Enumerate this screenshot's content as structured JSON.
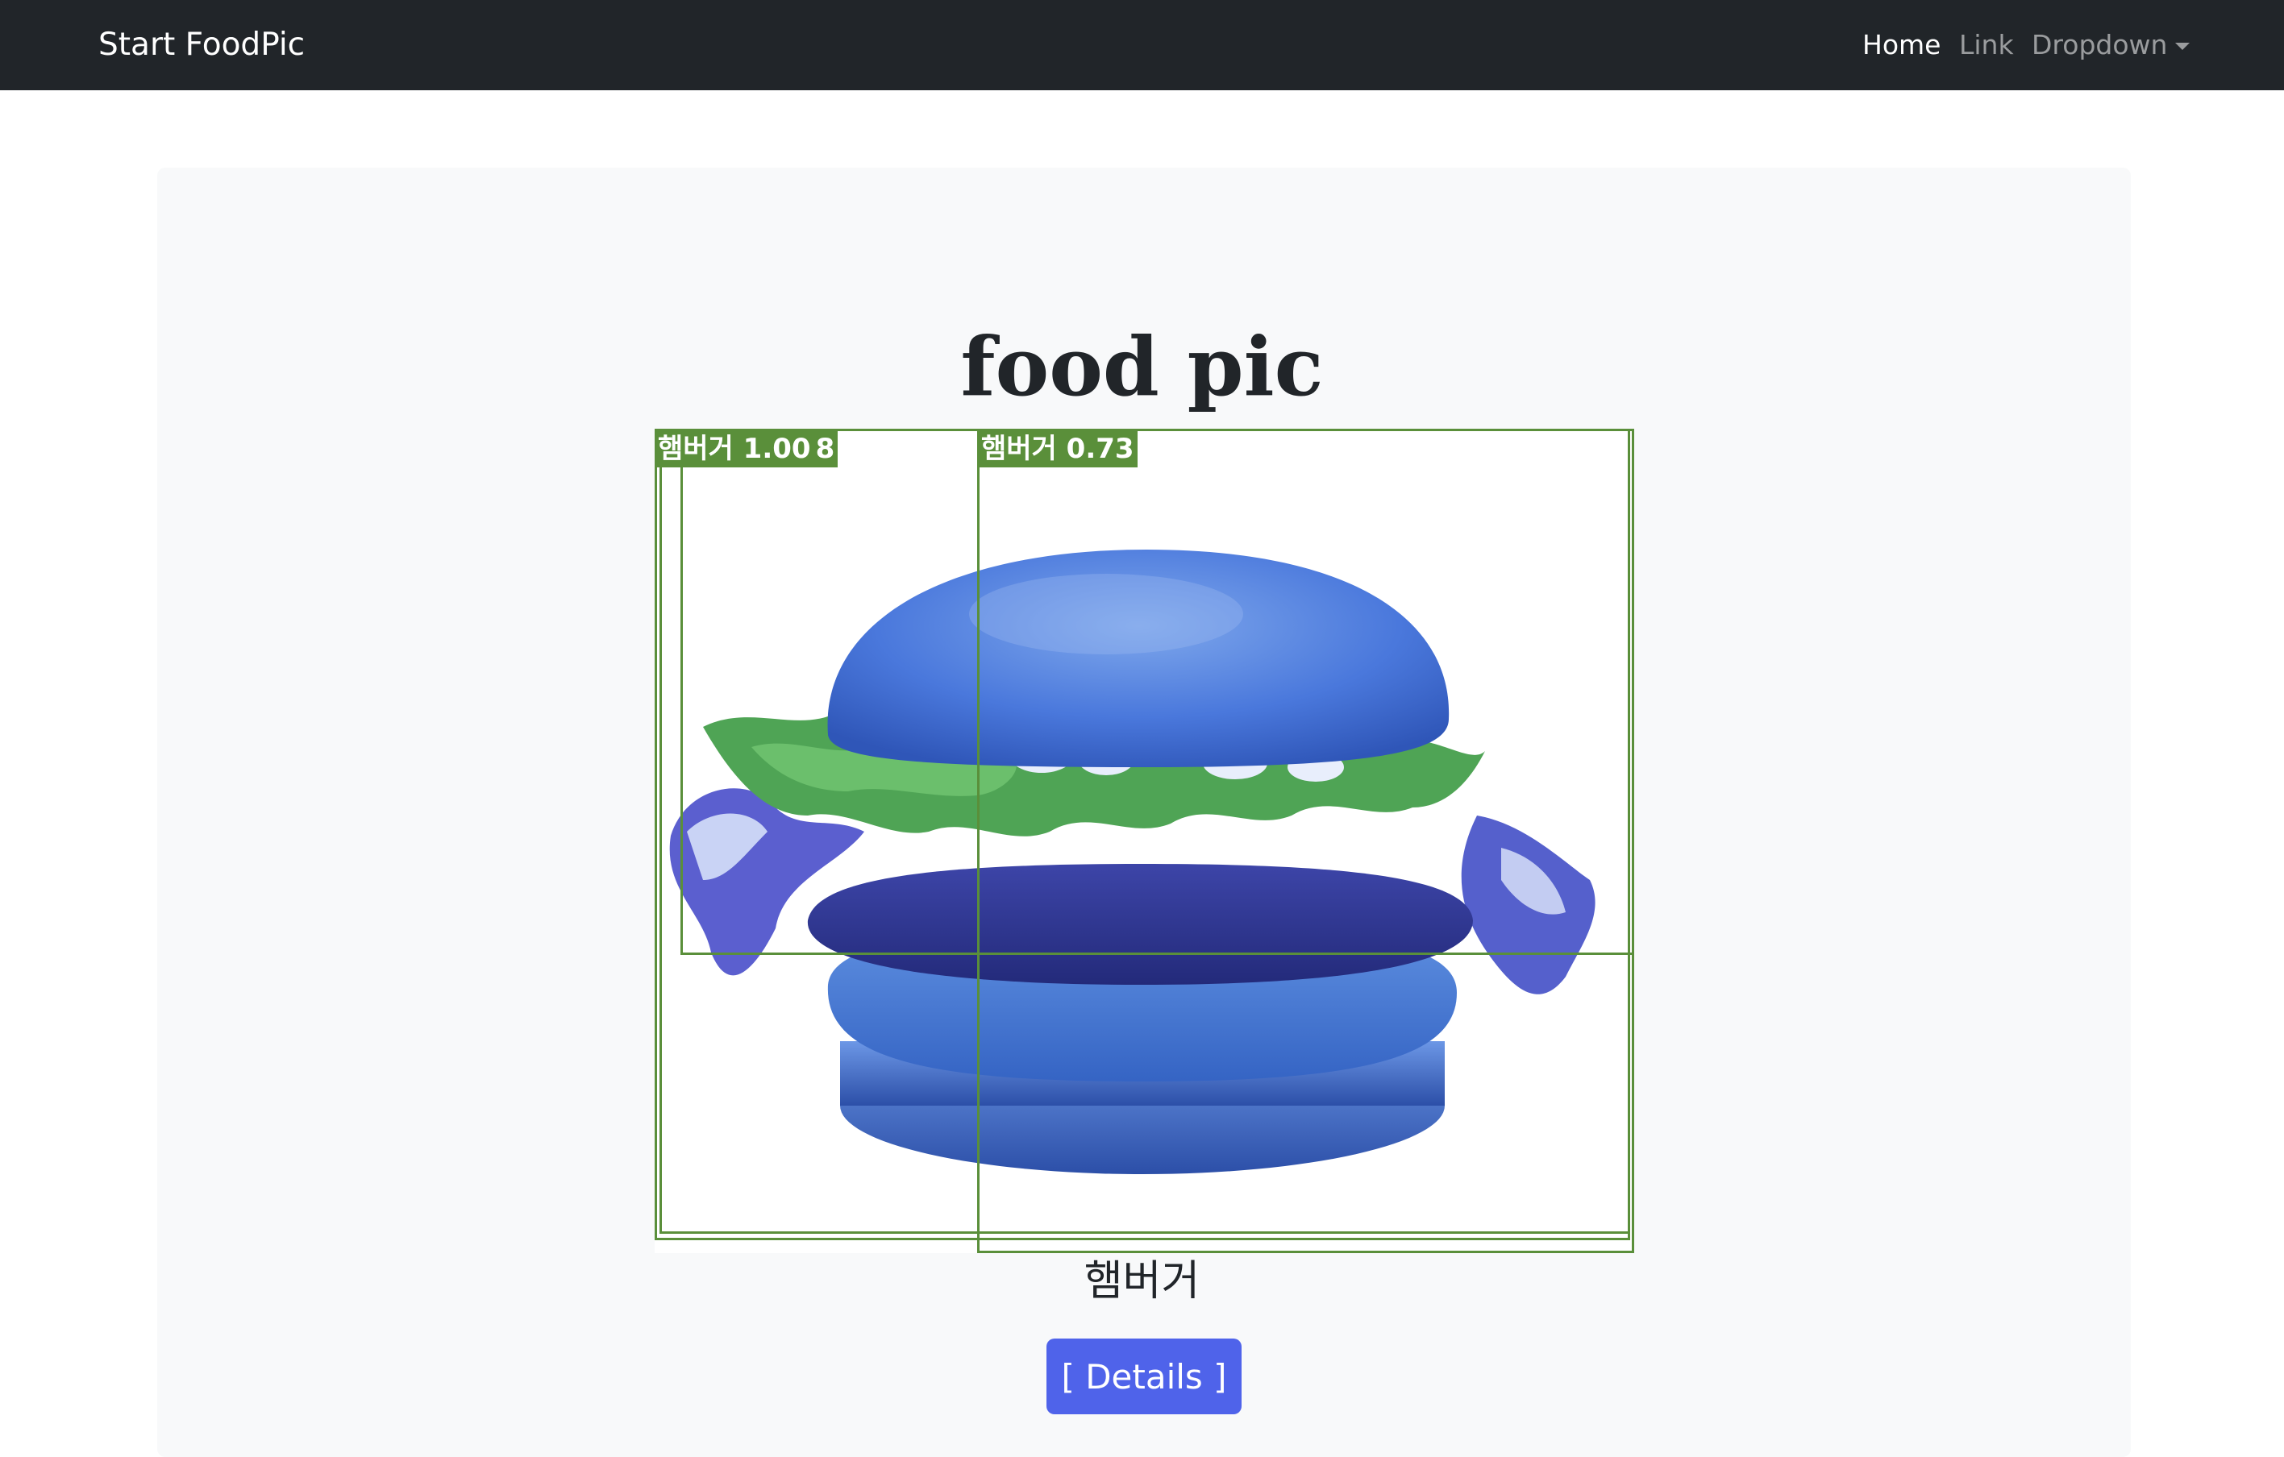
{
  "navbar": {
    "brand": "Start FoodPic",
    "items": [
      {
        "label": "Home",
        "active": true
      },
      {
        "label": "Link",
        "active": false
      },
      {
        "label": "Dropdown",
        "active": false
      }
    ]
  },
  "main": {
    "title": "food pic",
    "detections": [
      {
        "label": "햄버거 1.00",
        "overlap_text": "8"
      },
      {
        "label": "햄버거 0.73"
      }
    ],
    "image_subject": "blue hamburger photo",
    "caption": "햄버거",
    "details_button": "[ Details ]"
  },
  "colors": {
    "navbar_bg": "#212529",
    "panel_bg": "#f8f9fa",
    "detection_box": "#5a8f3a",
    "button_bg": "#4f63ea"
  }
}
